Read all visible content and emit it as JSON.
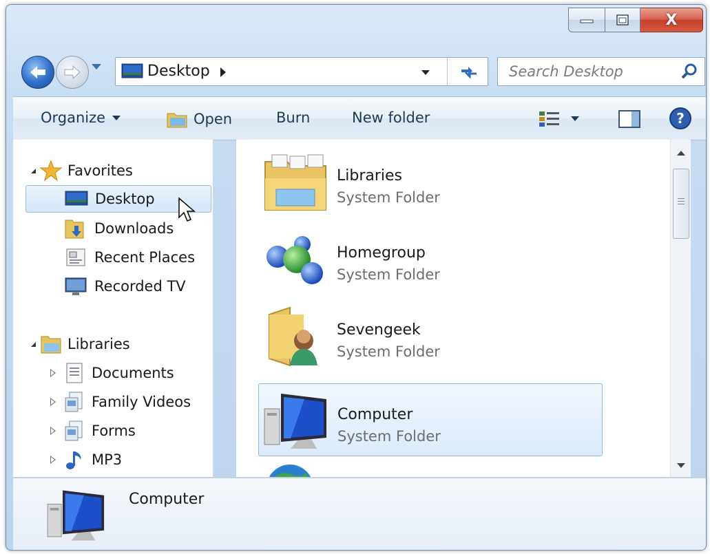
{
  "window": {
    "caption_buttons": {
      "minimize": "minimize",
      "maximize": "maximize",
      "close": "X"
    }
  },
  "address_bar": {
    "location": "Desktop",
    "search_placeholder": "Search Desktop"
  },
  "command_bar": {
    "organize": "Organize",
    "open": "Open",
    "burn": "Burn",
    "new_folder": "New folder"
  },
  "nav_pane": {
    "favorites": {
      "label": "Favorites",
      "items": [
        {
          "label": "Desktop",
          "icon": "desktop-icon",
          "selected": true
        },
        {
          "label": "Downloads",
          "icon": "downloads-folder-icon"
        },
        {
          "label": "Recent Places",
          "icon": "recent-places-icon"
        },
        {
          "label": "Recorded TV",
          "icon": "recorded-tv-icon"
        }
      ]
    },
    "libraries": {
      "label": "Libraries",
      "items": [
        {
          "label": "Documents",
          "icon": "document-library-icon"
        },
        {
          "label": "Family Videos",
          "icon": "library-icon"
        },
        {
          "label": "Forms",
          "icon": "library-icon"
        },
        {
          "label": "MP3",
          "icon": "music-note-icon"
        }
      ]
    }
  },
  "content": {
    "items": [
      {
        "name": "Libraries",
        "type": "System Folder",
        "icon": "libraries-folder-icon"
      },
      {
        "name": "Homegroup",
        "type": "System Folder",
        "icon": "homegroup-icon"
      },
      {
        "name": "Sevengeek",
        "type": "System Folder",
        "icon": "user-folder-icon"
      },
      {
        "name": "Computer",
        "type": "System Folder",
        "icon": "computer-icon",
        "selected": true
      }
    ]
  },
  "details_pane": {
    "name": "Computer",
    "icon": "computer-icon"
  },
  "colors": {
    "frame": "#bcd4ed",
    "selection": "#dcebfc",
    "close_button": "#c7402a"
  }
}
